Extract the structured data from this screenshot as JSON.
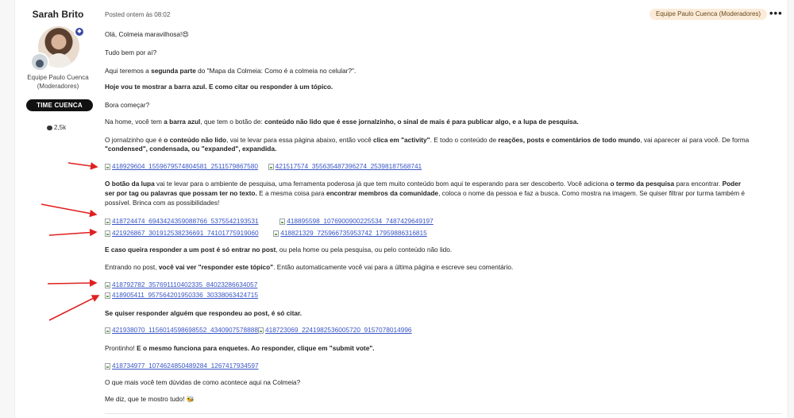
{
  "author": {
    "name": "Sarah Brito",
    "role": "Equipe Paulo Cuenca (Moderadores)",
    "team": "TIME CUENCA",
    "count": "2,5k"
  },
  "post": {
    "posted": "Posted ontem às 08:02",
    "mod_badge": "Equipe Paulo Cuenca (Moderadores)",
    "more": "•••"
  },
  "body": {
    "p1": "Olá, Colmeia maravilhosa!",
    "p1_emoji": "😍",
    "p2": "Tudo bem por aí?",
    "p3a": "Aqui teremos a ",
    "p3b": "segunda parte",
    "p3c": " do \"Mapa da Colmeia: Como é a colmeia no celular?\".",
    "p4": "Hoje vou te mostrar a barra azul. E como citar ou responder à um tópico.",
    "p5": "Bora começar?",
    "p6a": "Na home, você tem ",
    "p6b": "a barra azul",
    "p6c": ", que tem o botão de: ",
    "p6d": "conteúdo não lido que é esse jornalzinho, o sinal de mais é para publicar algo, e a lupa de pesquisa.",
    "p7a": "O jornalzinho que é ",
    "p7b": "o conteúdo não lido",
    "p7c": ", vai te levar para essa página abaixo, então você ",
    "p7d": "clica em \"activity\"",
    "p7e": ". E todo o conteúdo de ",
    "p7f": "reações, posts e comentários de todo mundo",
    "p7g": ", vai aparecer aí para você. De forma",
    "p7h": "\"condensed\", condensada, ou \"expanded\", expandida.",
    "img1": "418929604_1559679574804581_2511579867580",
    "img2": "421517574_355635487396274_2539818756874​1",
    "p8a": "O botão da lupa",
    "p8b": " vai te levar para o ambiente de pesquisa, uma ferramenta poderosa já que tem muito conteúdo bom aqui te esperando para ser descoberto. Você adiciona ",
    "p8c": "o termo da pesquisa",
    "p8d": " para encontrar. ",
    "p8e": "Poder",
    "p8f": "ser por tag ou palavras que possam ter no texto.",
    "p8g": " E a mesma coisa para ",
    "p8h": "encontrar membros da comunidade",
    "p8i": ", coloca o nome da pessoa e faz a busca. Como mostra na imagem. Se quiser filtrar por turma também é",
    "p8j": "possível. Brinca com as possibilidades!",
    "img3": "418724474_6943424359088766_5375542193531",
    "img4": "418895598_1076900900225534_7487429649197",
    "img5": "421926867_301912538236691_74101775919060",
    "img6": "418821329_725966735953742_17959886316815",
    "p9a": "E caso queira responder a um post é só entrar no post",
    "p9b": ", ou pela home ou pela pesquisa, ou pelo conteúdo não lido.",
    "p10a": "Entrando no post, ",
    "p10b": "você vai ver \"responder este tópico\"",
    "p10c": ". Então automaticamente você vai para a última página e escreve seu comentário.",
    "img7": "418792782_357691110402335_84023286634057",
    "img8": "418905411_957564201950336_30338063424715",
    "p11": "Se quiser responder alguém que respondeu ao post, é só citar.",
    "img9": "421938070_1156014598698552_4340907578888",
    "img10": "418723069_2241982536005720_9157078014996",
    "p12a": "Prontinho! ",
    "p12b": "E o mesmo funciona para enquetes. Ao responder, clique em \"submit vote\".",
    "img11": "418734977_1074624850489284_1267417934597",
    "p13": "O que mais você tem dúvidas de como acontece aqui na Colmeia?",
    "p14": "Me diz, que te mostro tudo!",
    "p14_emoji": "🐝"
  },
  "colors": {
    "arrow": "#e02020",
    "link": "#3a56c6",
    "badge_bg": "#fbebd8"
  }
}
